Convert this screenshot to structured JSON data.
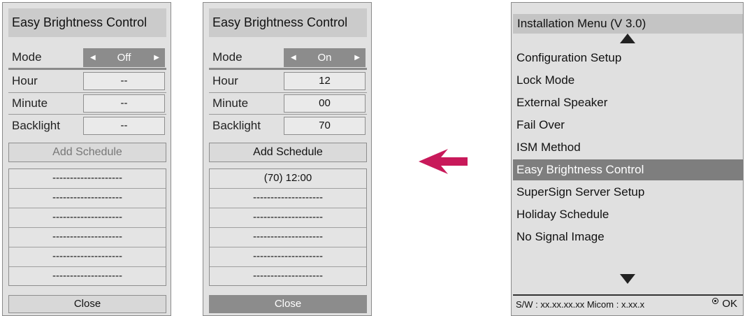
{
  "panel_off": {
    "title": "Easy Brightness Control",
    "mode_label": "Mode",
    "mode_value": "Off",
    "hour_label": "Hour",
    "hour_value": "--",
    "minute_label": "Minute",
    "minute_value": "--",
    "backlight_label": "Backlight",
    "backlight_value": "--",
    "add_schedule_label": "Add Schedule",
    "schedule_items": [
      "--------------------",
      "--------------------",
      "--------------------",
      "--------------------",
      "--------------------",
      "--------------------"
    ],
    "close_label": "Close"
  },
  "panel_on": {
    "title": "Easy Brightness Control",
    "mode_label": "Mode",
    "mode_value": "On",
    "hour_label": "Hour",
    "hour_value": "12",
    "minute_label": "Minute",
    "minute_value": "00",
    "backlight_label": "Backlight",
    "backlight_value": "70",
    "add_schedule_label": "Add Schedule",
    "schedule_items": [
      "(70)   12:00",
      "--------------------",
      "--------------------",
      "--------------------",
      "--------------------",
      "--------------------"
    ],
    "close_label": "Close"
  },
  "arrow_color": "#c8195a",
  "installation_menu": {
    "title": "Installation Menu (V 3.0)",
    "items": [
      "Configuration Setup",
      "Lock Mode",
      "External Speaker",
      "Fail Over",
      "ISM Method",
      "Easy Brightness Control",
      "SuperSign Server Setup",
      "Holiday Schedule",
      "No Signal Image"
    ],
    "selected_item": "Easy Brightness Control",
    "footer_text": "S/W : xx.xx.xx.xx Micom : x.xx.x",
    "ok_label": "OK"
  },
  "icons": {
    "left_arrow": "arrow-left-icon",
    "right_arrow": "arrow-right-icon",
    "scroll_up": "scroll-up-icon",
    "scroll_down": "scroll-down-icon",
    "ok": "ok-icon",
    "back_arrow": "back-arrow-icon"
  }
}
